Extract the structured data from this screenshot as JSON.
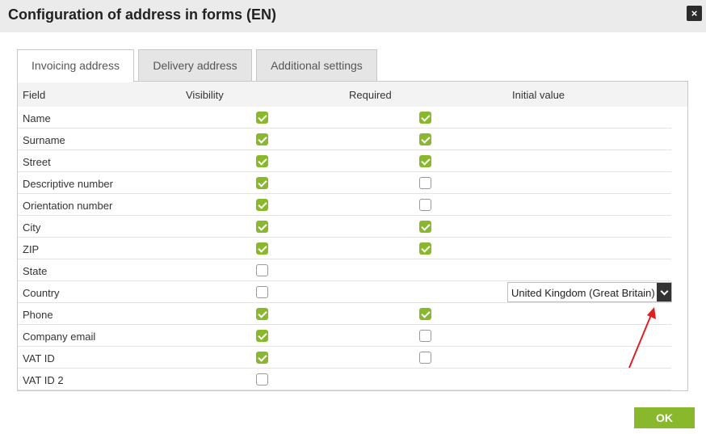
{
  "dialog": {
    "title": "Configuration of address in forms (EN)",
    "close_label": "×"
  },
  "tabs": [
    {
      "label": "Invoicing address",
      "active": true
    },
    {
      "label": "Delivery address",
      "active": false
    },
    {
      "label": "Additional settings",
      "active": false
    }
  ],
  "table": {
    "headers": {
      "field": "Field",
      "visibility": "Visibility",
      "required": "Required",
      "initial_value": "Initial value"
    },
    "rows": [
      {
        "label": "Name",
        "visibility": true,
        "required": true
      },
      {
        "label": "Surname",
        "visibility": true,
        "required": true
      },
      {
        "label": "Street",
        "visibility": true,
        "required": true
      },
      {
        "label": "Descriptive number",
        "visibility": true,
        "required": false
      },
      {
        "label": "Orientation number",
        "visibility": true,
        "required": false
      },
      {
        "label": "City",
        "visibility": true,
        "required": true
      },
      {
        "label": "ZIP",
        "visibility": true,
        "required": true
      },
      {
        "label": "State",
        "visibility": false,
        "required": null
      },
      {
        "label": "Country",
        "visibility": false,
        "required": null,
        "initial_value": "United Kingdom (Great Britain)"
      },
      {
        "label": "Phone",
        "visibility": true,
        "required": true
      },
      {
        "label": "Company email",
        "visibility": true,
        "required": false
      },
      {
        "label": "VAT ID",
        "visibility": true,
        "required": false
      },
      {
        "label": "VAT ID 2",
        "visibility": false,
        "required": null
      }
    ]
  },
  "footer": {
    "ok_label": "OK"
  },
  "colors": {
    "accent": "#8ab82d",
    "annotation_arrow": "#e02020"
  }
}
